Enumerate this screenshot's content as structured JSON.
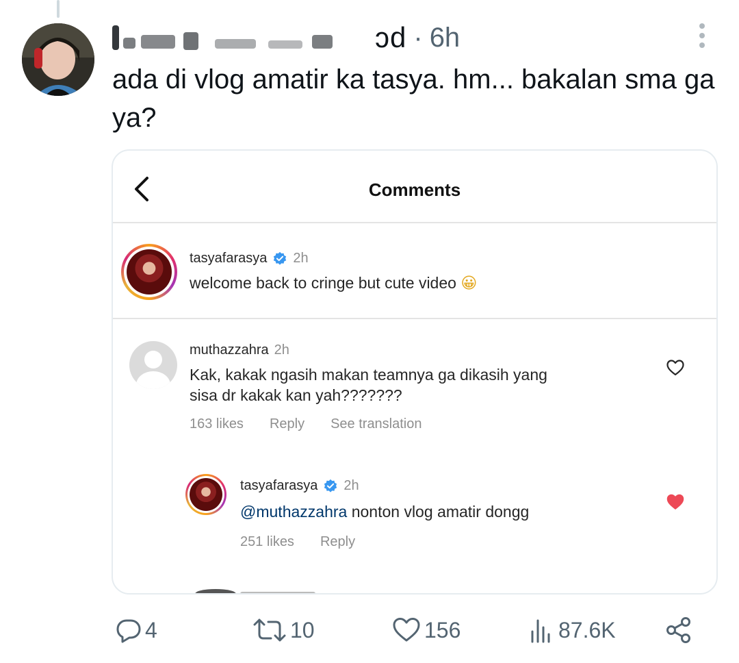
{
  "tweet": {
    "author_name_visible_tail": "ɔd",
    "separator": "·",
    "time": "6h",
    "text": "ada di vlog amatir ka tasya. hm... bakalan sma ga ya?"
  },
  "embedded_screenshot": {
    "title": "Comments",
    "comments": [
      {
        "username": "tasyafarasya",
        "verified": true,
        "time": "2h",
        "text": "welcome back to cringe but cute video",
        "emoji": "😀"
      },
      {
        "username": "muthazzahra",
        "verified": false,
        "time": "2h",
        "text_line1": "Kak, kakak ngasih makan teamnya ga dikasih yang",
        "text_line2": "sisa dr kakak kan yah???????",
        "likes": "163 likes",
        "reply": "Reply",
        "see_translation": "See translation",
        "liked": false
      },
      {
        "username": "tasyafarasya",
        "verified": true,
        "time": "2h",
        "mention": "@muthazzahra",
        "text": " nonton vlog amatir dongg",
        "likes": "251 likes",
        "reply": "Reply",
        "liked": true
      }
    ]
  },
  "actions": {
    "replies": "4",
    "retweets": "10",
    "likes": "156",
    "views": "87.6K"
  },
  "colors": {
    "verified_blue": "#3897f0",
    "liked_red": "#ed4956",
    "secondary_text": "#536471",
    "mention_blue": "#00376b"
  }
}
